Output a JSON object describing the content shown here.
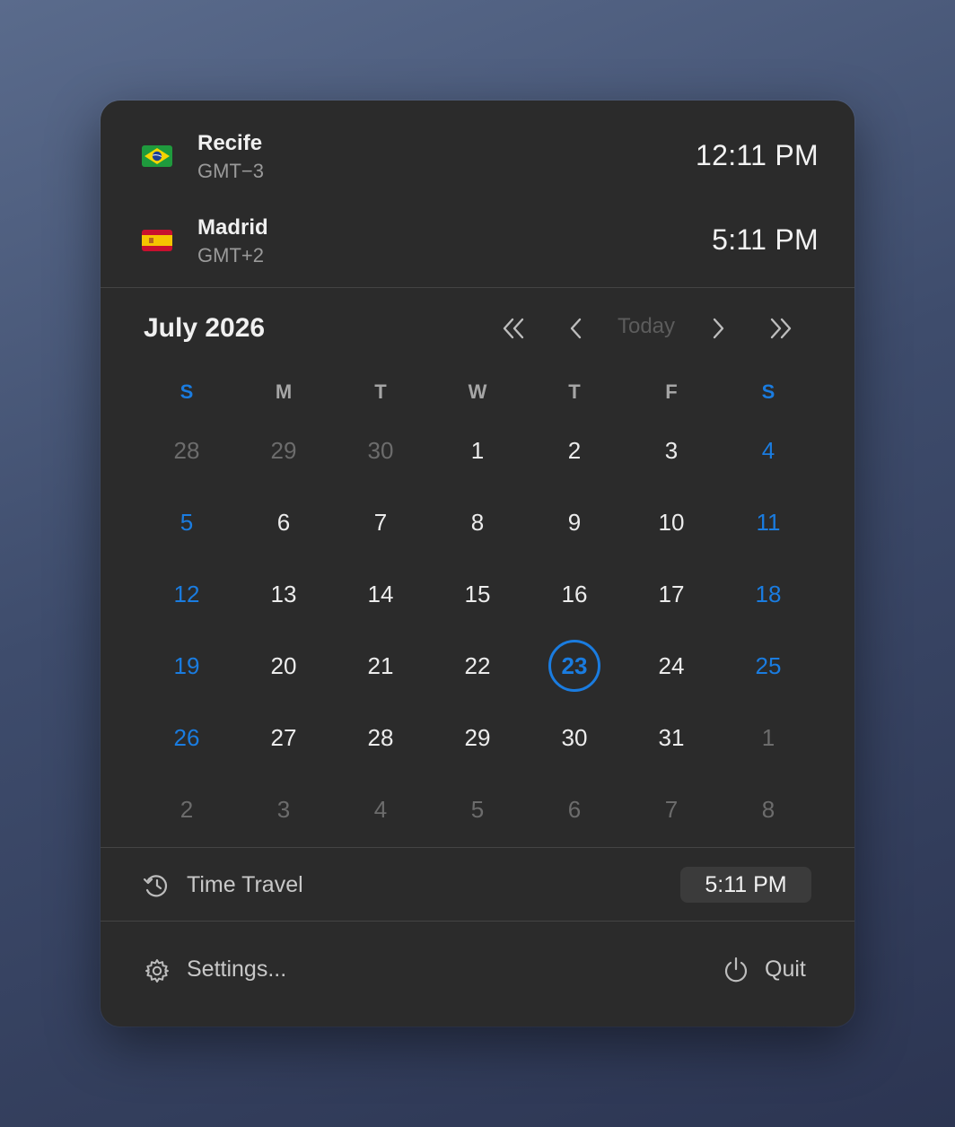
{
  "clocks": [
    {
      "city": "Recife",
      "tz": "GMT−3",
      "time": "12:11 PM",
      "flag": "brazil-flag-icon"
    },
    {
      "city": "Madrid",
      "tz": "GMT+2",
      "time": "5:11 PM",
      "flag": "spain-flag-icon"
    }
  ],
  "calendar": {
    "month_label": "July 2026",
    "nav": {
      "prev_year_icon": "double-chevron-left-icon",
      "prev_month_icon": "chevron-left-icon",
      "today_label": "Today",
      "next_month_icon": "chevron-right-icon",
      "next_year_icon": "double-chevron-right-icon"
    },
    "weekdays": [
      "S",
      "M",
      "T",
      "W",
      "T",
      "F",
      "S"
    ],
    "weeks": [
      [
        "28",
        "29",
        "30",
        "1",
        "2",
        "3",
        "4"
      ],
      [
        "5",
        "6",
        "7",
        "8",
        "9",
        "10",
        "11"
      ],
      [
        "12",
        "13",
        "14",
        "15",
        "16",
        "17",
        "18"
      ],
      [
        "19",
        "20",
        "21",
        "22",
        "23",
        "24",
        "25"
      ],
      [
        "26",
        "27",
        "28",
        "29",
        "30",
        "31",
        "1"
      ],
      [
        "2",
        "3",
        "4",
        "5",
        "6",
        "7",
        "8"
      ]
    ],
    "today": "23"
  },
  "time_travel": {
    "icon": "history-clock-icon",
    "label": "Time Travel",
    "value": "5:11 PM"
  },
  "footer": {
    "settings_icon": "gear-icon",
    "settings_label": "Settings...",
    "quit_icon": "power-icon",
    "quit_label": "Quit"
  },
  "colors": {
    "accent": "#1a7ce0",
    "panel_bg": "#2b2b2b"
  }
}
